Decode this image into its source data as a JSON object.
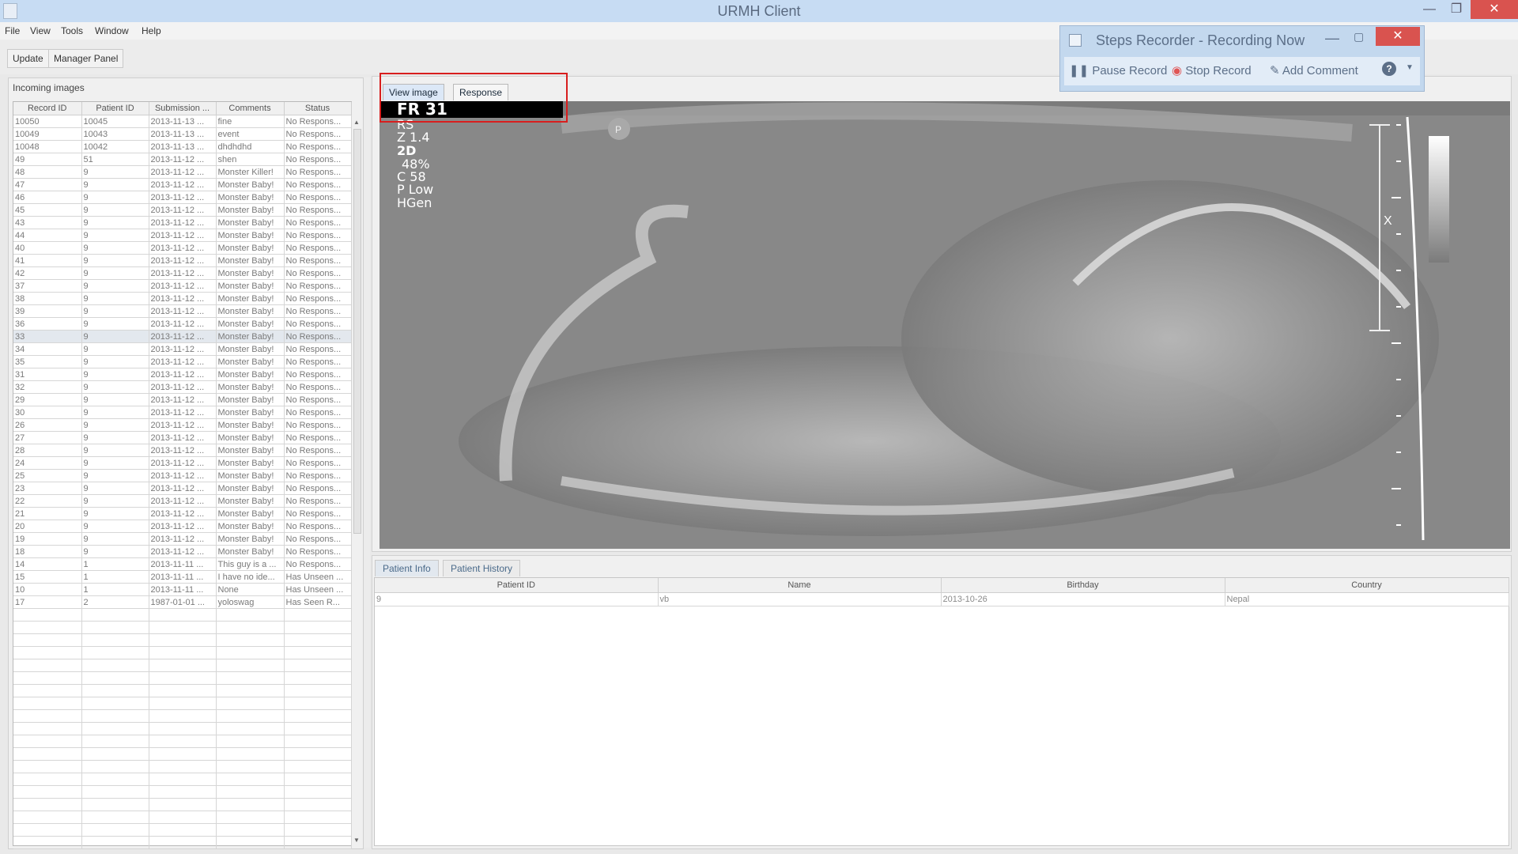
{
  "window": {
    "title": "URMH Client"
  },
  "menu": [
    "File",
    "View",
    "Tools",
    "Window",
    "Help"
  ],
  "toolbar": {
    "update": "Update",
    "manager": "Manager Panel"
  },
  "incoming": {
    "title": "Incoming images",
    "columns": [
      "Record ID",
      "Patient ID",
      "Submission ...",
      "Comments",
      "Status"
    ],
    "rows": [
      [
        "10050",
        "10045",
        "2013-11-13 ...",
        "fine",
        "No Respons..."
      ],
      [
        "10049",
        "10043",
        "2013-11-13 ...",
        "event",
        "No Respons..."
      ],
      [
        "10048",
        "10042",
        "2013-11-13 ...",
        "dhdhdhd",
        "No Respons..."
      ],
      [
        "49",
        "51",
        "2013-11-12 ...",
        "shen",
        "No Respons..."
      ],
      [
        "48",
        "9",
        "2013-11-12 ...",
        "Monster Killer!",
        "No Respons..."
      ],
      [
        "47",
        "9",
        "2013-11-12 ...",
        "Monster Baby!",
        "No Respons..."
      ],
      [
        "46",
        "9",
        "2013-11-12 ...",
        "Monster Baby!",
        "No Respons..."
      ],
      [
        "45",
        "9",
        "2013-11-12 ...",
        "Monster Baby!",
        "No Respons..."
      ],
      [
        "43",
        "9",
        "2013-11-12 ...",
        "Monster Baby!",
        "No Respons..."
      ],
      [
        "44",
        "9",
        "2013-11-12 ...",
        "Monster Baby!",
        "No Respons..."
      ],
      [
        "40",
        "9",
        "2013-11-12 ...",
        "Monster Baby!",
        "No Respons..."
      ],
      [
        "41",
        "9",
        "2013-11-12 ...",
        "Monster Baby!",
        "No Respons..."
      ],
      [
        "42",
        "9",
        "2013-11-12 ...",
        "Monster Baby!",
        "No Respons..."
      ],
      [
        "37",
        "9",
        "2013-11-12 ...",
        "Monster Baby!",
        "No Respons..."
      ],
      [
        "38",
        "9",
        "2013-11-12 ...",
        "Monster Baby!",
        "No Respons..."
      ],
      [
        "39",
        "9",
        "2013-11-12 ...",
        "Monster Baby!",
        "No Respons..."
      ],
      [
        "36",
        "9",
        "2013-11-12 ...",
        "Monster Baby!",
        "No Respons..."
      ],
      [
        "33",
        "9",
        "2013-11-12 ...",
        "Monster Baby!",
        "No Respons..."
      ],
      [
        "34",
        "9",
        "2013-11-12 ...",
        "Monster Baby!",
        "No Respons..."
      ],
      [
        "35",
        "9",
        "2013-11-12 ...",
        "Monster Baby!",
        "No Respons..."
      ],
      [
        "31",
        "9",
        "2013-11-12 ...",
        "Monster Baby!",
        "No Respons..."
      ],
      [
        "32",
        "9",
        "2013-11-12 ...",
        "Monster Baby!",
        "No Respons..."
      ],
      [
        "29",
        "9",
        "2013-11-12 ...",
        "Monster Baby!",
        "No Respons..."
      ],
      [
        "30",
        "9",
        "2013-11-12 ...",
        "Monster Baby!",
        "No Respons..."
      ],
      [
        "26",
        "9",
        "2013-11-12 ...",
        "Monster Baby!",
        "No Respons..."
      ],
      [
        "27",
        "9",
        "2013-11-12 ...",
        "Monster Baby!",
        "No Respons..."
      ],
      [
        "28",
        "9",
        "2013-11-12 ...",
        "Monster Baby!",
        "No Respons..."
      ],
      [
        "24",
        "9",
        "2013-11-12 ...",
        "Monster Baby!",
        "No Respons..."
      ],
      [
        "25",
        "9",
        "2013-11-12 ...",
        "Monster Baby!",
        "No Respons..."
      ],
      [
        "23",
        "9",
        "2013-11-12 ...",
        "Monster Baby!",
        "No Respons..."
      ],
      [
        "22",
        "9",
        "2013-11-12 ...",
        "Monster Baby!",
        "No Respons..."
      ],
      [
        "21",
        "9",
        "2013-11-12 ...",
        "Monster Baby!",
        "No Respons..."
      ],
      [
        "20",
        "9",
        "2013-11-12 ...",
        "Monster Baby!",
        "No Respons..."
      ],
      [
        "19",
        "9",
        "2013-11-12 ...",
        "Monster Baby!",
        "No Respons..."
      ],
      [
        "18",
        "9",
        "2013-11-12 ...",
        "Monster Baby!",
        "No Respons..."
      ],
      [
        "14",
        "1",
        "2013-11-11 ...",
        "This guy is a ...",
        "No Respons..."
      ],
      [
        "15",
        "1",
        "2013-11-11 ...",
        "I have no ide...",
        "Has Unseen ..."
      ],
      [
        "10",
        "1",
        "2013-11-11 ...",
        "None",
        "Has Unseen ..."
      ],
      [
        "17",
        "2",
        "1987-01-01 ...",
        "yoloswag",
        "Has Seen R..."
      ]
    ],
    "selected_row": 17
  },
  "image_tabs": {
    "view": "View image",
    "response": "Response"
  },
  "ultrasound": {
    "overlay": [
      "FR 31",
      "RS",
      "Z 1.4",
      "2D",
      "48%",
      "C 58",
      "P Low",
      "HGen"
    ],
    "probe_marker": "P",
    "scale_marker": "X"
  },
  "recorder": {
    "title": "Steps Recorder - Recording Now",
    "pause": "Pause Record",
    "stop": "Stop Record",
    "comment": "Add Comment",
    "help": "?"
  },
  "patient_tabs": {
    "info": "Patient Info",
    "history": "Patient History"
  },
  "patient": {
    "columns": [
      "Patient ID",
      "Name",
      "Birthday",
      "Country"
    ],
    "row": [
      "9",
      "vb",
      "2013-10-26",
      "Nepal"
    ]
  }
}
